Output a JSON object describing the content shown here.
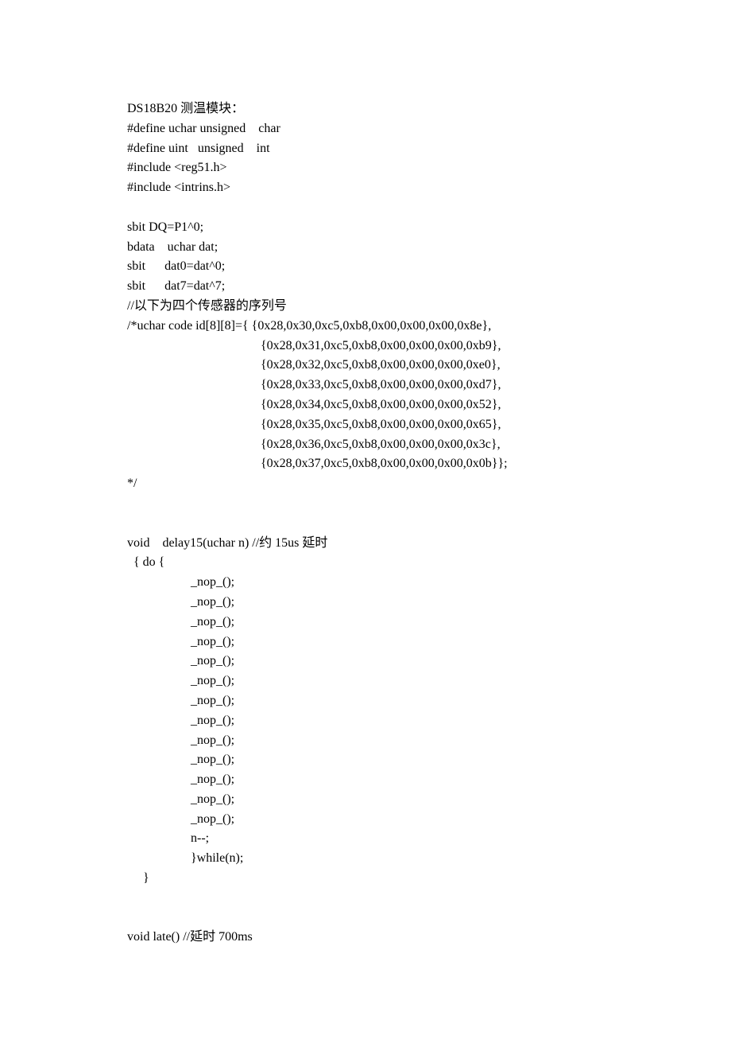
{
  "lines": [
    "DS18B20 测温模块：",
    "#define uchar unsigned    char",
    "#define uint   unsigned    int",
    "#include <reg51.h>",
    "#include <intrins.h>",
    "",
    "sbit DQ=P1^0;",
    "bdata    uchar dat;",
    "sbit      dat0=dat^0;",
    "sbit      dat7=dat^7;",
    "//以下为四个传感器的序列号",
    "/*uchar code id[8][8]={ {0x28,0x30,0xc5,0xb8,0x00,0x00,0x00,0x8e},",
    "                                          {0x28,0x31,0xc5,0xb8,0x00,0x00,0x00,0xb9},",
    "                                          {0x28,0x32,0xc5,0xb8,0x00,0x00,0x00,0xe0},",
    "                                          {0x28,0x33,0xc5,0xb8,0x00,0x00,0x00,0xd7},",
    "                                          {0x28,0x34,0xc5,0xb8,0x00,0x00,0x00,0x52},",
    "                                          {0x28,0x35,0xc5,0xb8,0x00,0x00,0x00,0x65},",
    "                                          {0x28,0x36,0xc5,0xb8,0x00,0x00,0x00,0x3c},",
    "                                          {0x28,0x37,0xc5,0xb8,0x00,0x00,0x00,0x0b}};",
    "*/",
    "",
    "",
    "void    delay15(uchar n) //约 15us 延时",
    "  { do {",
    "                    _nop_();",
    "                    _nop_();",
    "                    _nop_();",
    "                    _nop_();",
    "                    _nop_();",
    "                    _nop_();",
    "                    _nop_();",
    "                    _nop_();",
    "                    _nop_();",
    "                    _nop_();",
    "                    _nop_();",
    "                    _nop_();",
    "                    _nop_();",
    "                    n--;",
    "                    }while(n);",
    "     }",
    "",
    "",
    "void late() //延时 700ms"
  ]
}
